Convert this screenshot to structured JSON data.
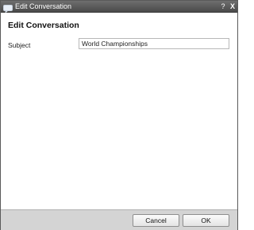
{
  "window": {
    "title": "Edit Conversation",
    "help_label": "?",
    "close_label": "X",
    "title_icon": "chat-bubble-icon"
  },
  "form": {
    "heading": "Edit Conversation",
    "subject_label": "Subject",
    "subject_value": "World Championships"
  },
  "footer": {
    "cancel_label": "Cancel",
    "ok_label": "OK"
  },
  "colors": {
    "titlebar": "#5c5c5c",
    "footer": "#d4d4d4",
    "border": "#5a5a5a"
  }
}
